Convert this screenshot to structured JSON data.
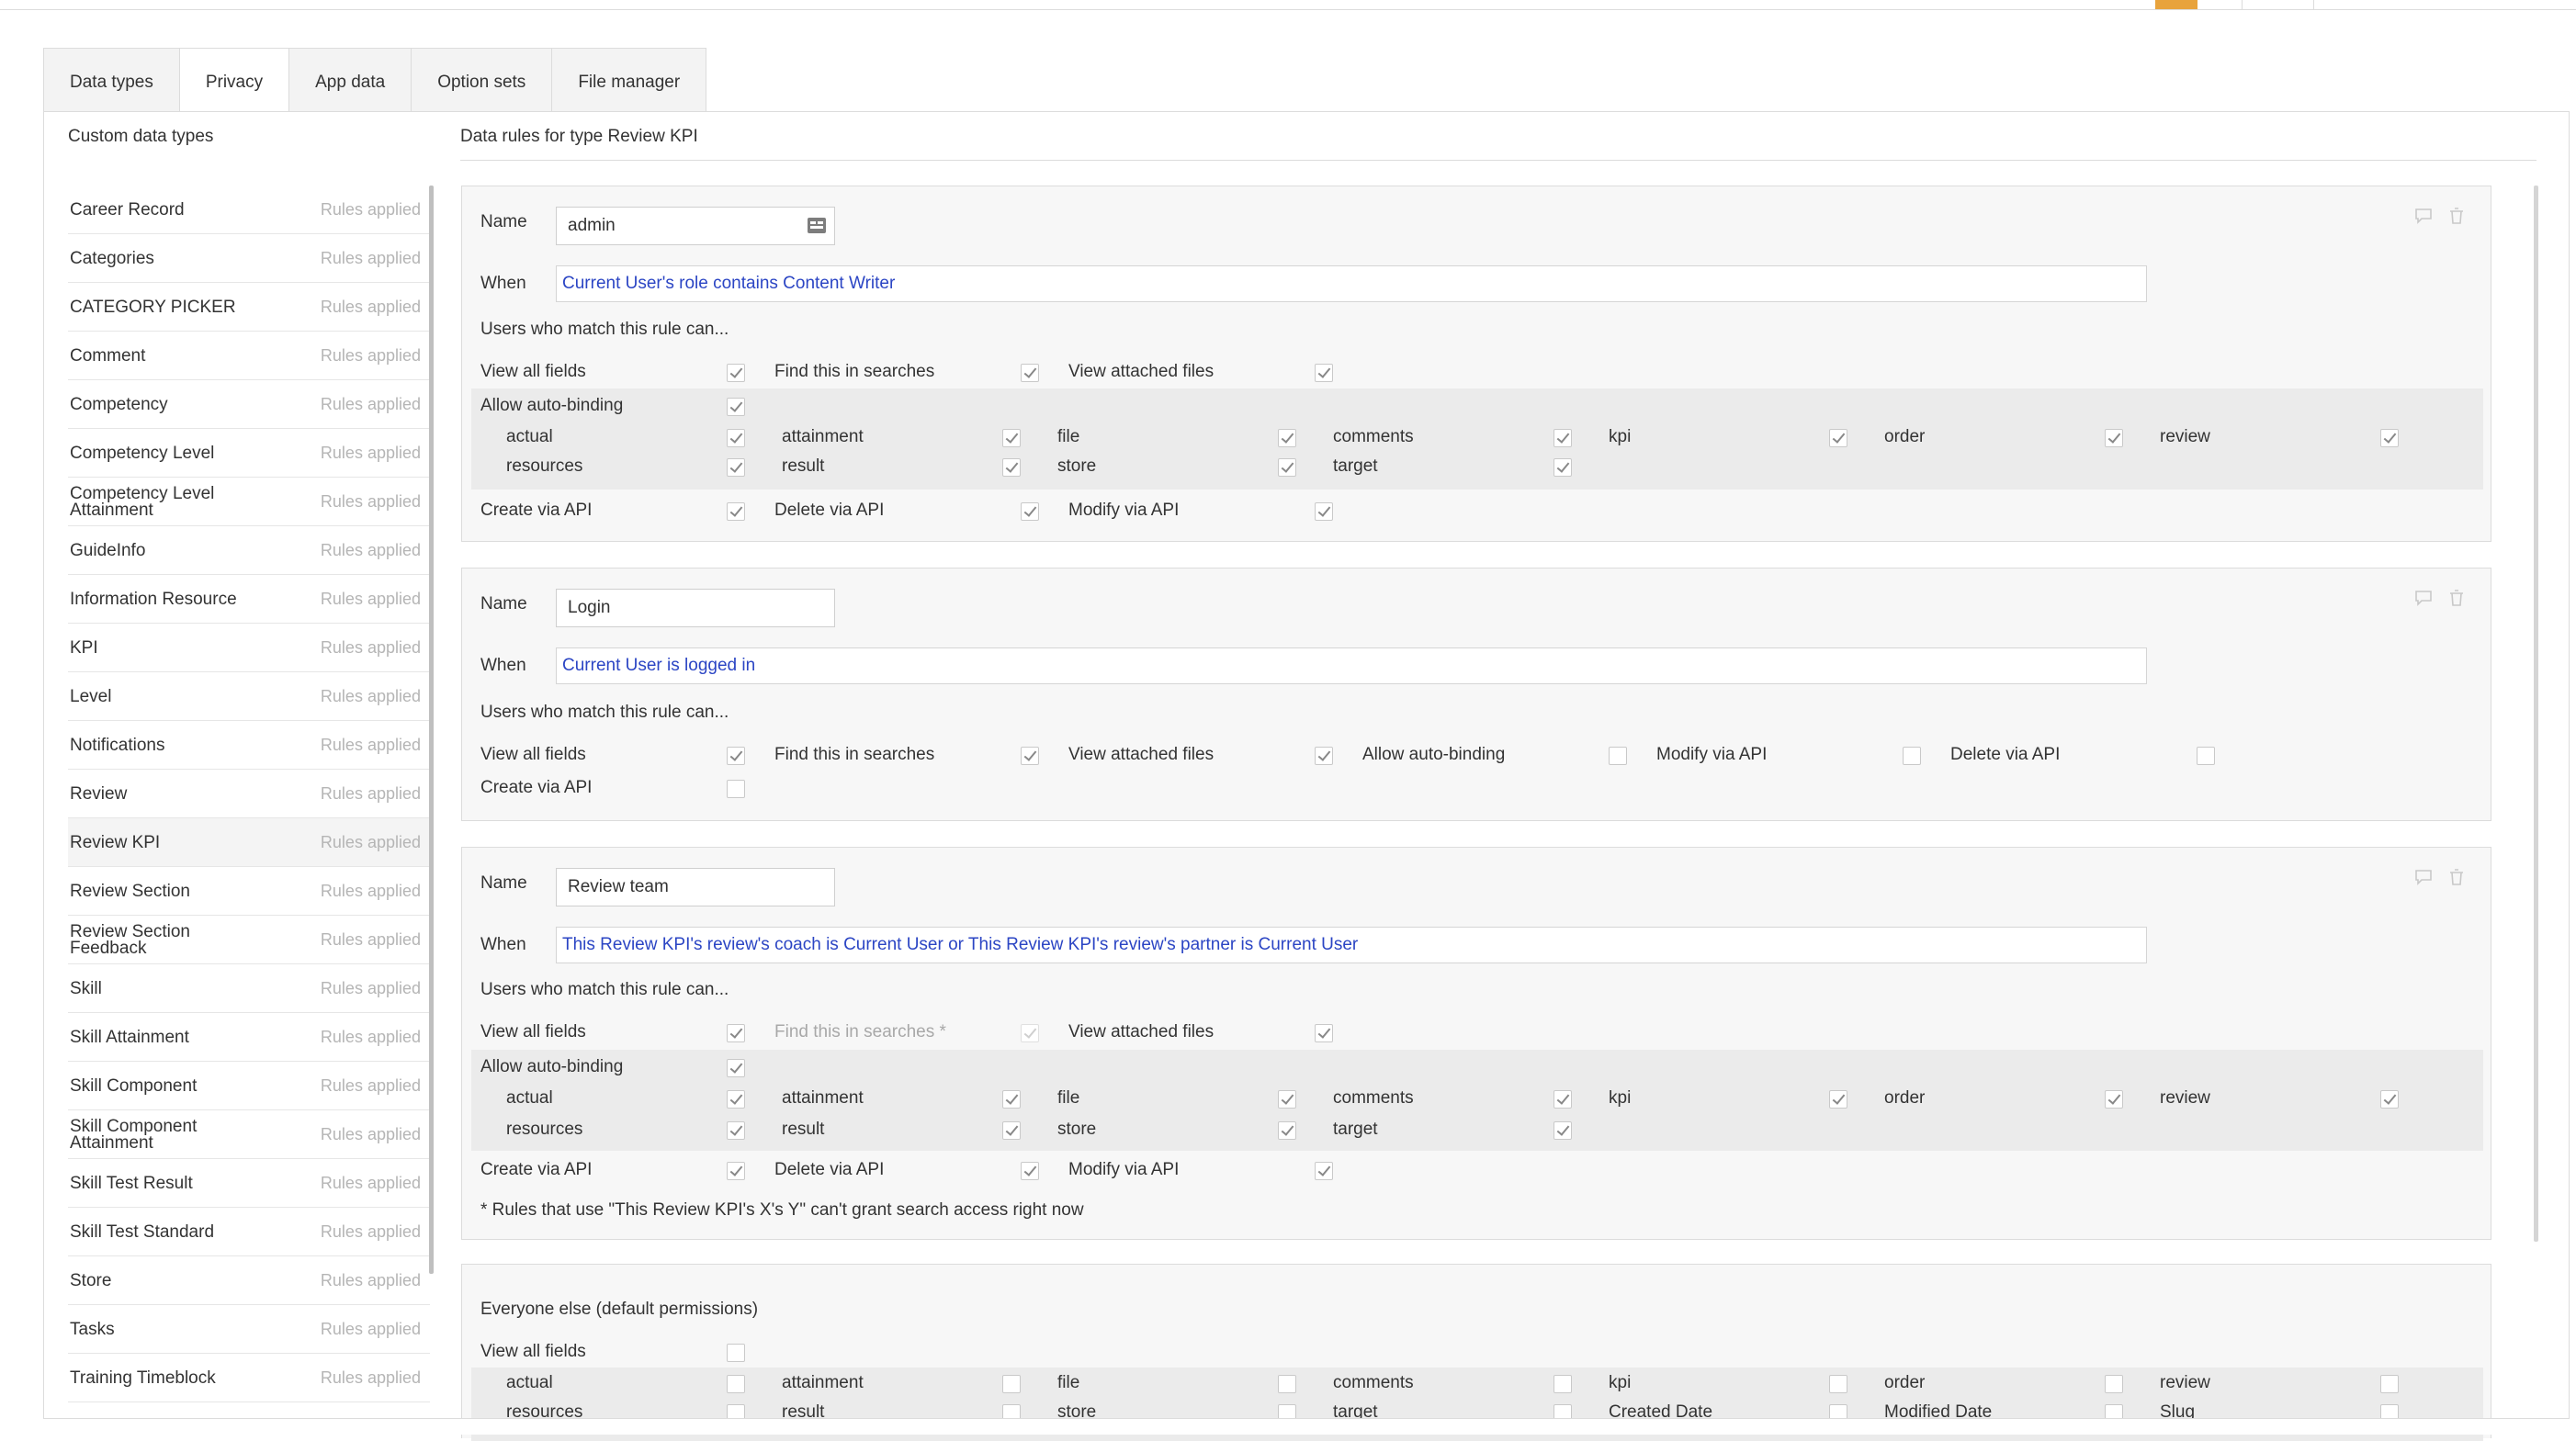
{
  "tabs": [
    {
      "label": "Data types"
    },
    {
      "label": "Privacy"
    },
    {
      "label": "App data"
    },
    {
      "label": "Option sets"
    },
    {
      "label": "File manager"
    }
  ],
  "left_header": "Custom data types",
  "right_header": "Data rules for type Review KPI",
  "rules_applied": "Rules applied",
  "data_types": [
    {
      "label": "Career Record"
    },
    {
      "label": "Categories"
    },
    {
      "label": "CATEGORY PICKER"
    },
    {
      "label": "Comment"
    },
    {
      "label": "Competency"
    },
    {
      "label": "Competency Level"
    },
    {
      "label": "Competency Level Attainment"
    },
    {
      "label": "GuideInfo"
    },
    {
      "label": "Information Resource"
    },
    {
      "label": "KPI"
    },
    {
      "label": "Level"
    },
    {
      "label": "Notifications"
    },
    {
      "label": "Review"
    },
    {
      "label": "Review KPI"
    },
    {
      "label": "Review Section"
    },
    {
      "label": "Review Section Feedback"
    },
    {
      "label": "Skill"
    },
    {
      "label": "Skill Attainment"
    },
    {
      "label": "Skill Component"
    },
    {
      "label": "Skill Component Attainment"
    },
    {
      "label": "Skill Test Result"
    },
    {
      "label": "Skill Test Standard"
    },
    {
      "label": "Store"
    },
    {
      "label": "Tasks"
    },
    {
      "label": "Training Timeblock"
    }
  ],
  "labels": {
    "name": "Name",
    "when": "When",
    "users_match": "Users who match this rule can...",
    "view_all_fields": "View all fields",
    "find_in_searches": "Find this in searches",
    "find_in_searches_star": "Find this in searches *",
    "view_attached_files": "View attached files",
    "allow_auto_binding": "Allow auto-binding",
    "create_via_api": "Create via API",
    "delete_via_api": "Delete via API",
    "modify_via_api": "Modify via API"
  },
  "fields_row1": [
    "actual",
    "attainment",
    "file",
    "comments",
    "kpi",
    "order",
    "review"
  ],
  "fields_row2": [
    "resources",
    "result",
    "store",
    "target"
  ],
  "fields_row2_default": [
    "resources",
    "result",
    "store",
    "target",
    "Created Date",
    "Modified Date",
    "Slug"
  ],
  "rules": [
    {
      "name": "admin",
      "condition": "Current User's role contains Content Writer"
    },
    {
      "name": "Login",
      "condition": "Current User is logged in"
    },
    {
      "name": "Review team",
      "condition": "This Review KPI's review's coach is Current User or This Review KPI's review's partner is Current User",
      "note": "* Rules that use \"This Review KPI's X's Y\" can't grant search access right now"
    }
  ],
  "default_permissions": {
    "title": "Everyone else (default permissions)"
  }
}
